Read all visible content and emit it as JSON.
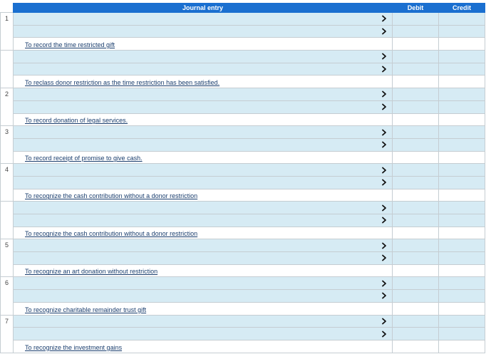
{
  "header": {
    "journal_entry": "Journal entry",
    "debit": "Debit",
    "credit": "Credit"
  },
  "groups": [
    {
      "number": "1",
      "memo": "To record the time restricted gift"
    },
    {
      "number": "",
      "memo": "To reclass donor restriction as the time restriction has been satisfied."
    },
    {
      "number": "2",
      "memo": "To record donation of legal services."
    },
    {
      "number": "3",
      "memo": "To record receipt of promise to give cash."
    },
    {
      "number": "4",
      "memo": "To recognize the cash contribution without a donor restriction"
    },
    {
      "number": "",
      "memo": "To recognize the cash contribution without a donor restriction"
    },
    {
      "number": "5",
      "memo": "To recognize an art donation without restriction"
    },
    {
      "number": "6",
      "memo": "To recognize charitable remainder trust gift"
    },
    {
      "number": "7",
      "memo": "To recognize the investment gains"
    }
  ]
}
